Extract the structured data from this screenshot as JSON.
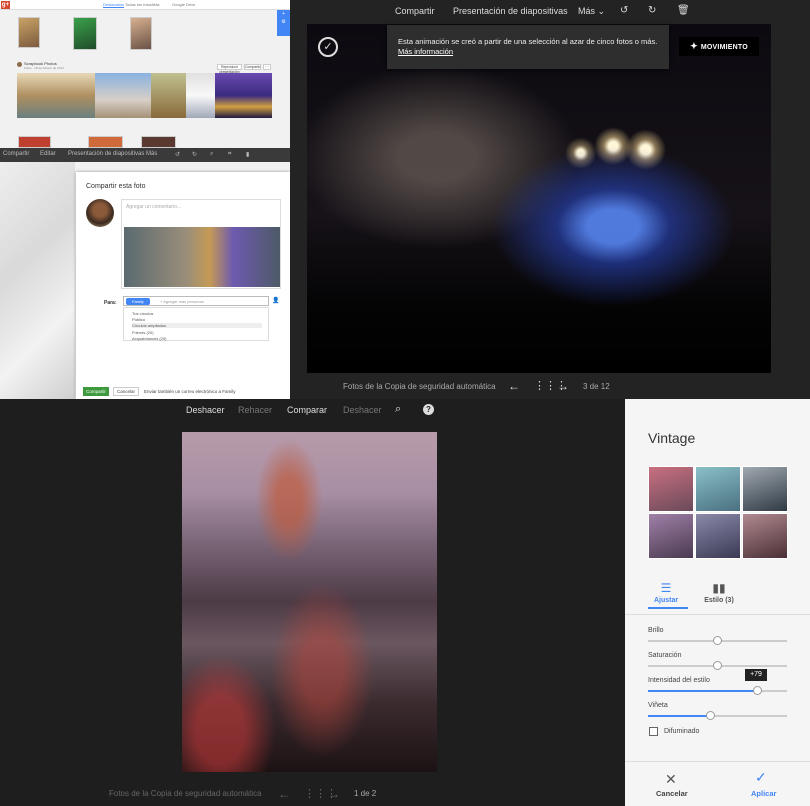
{
  "top_left": {
    "nav": {
      "item1": "Destacados",
      "item2": "Todas tus fotos",
      "item3": "Más",
      "item4": "Google Drive"
    },
    "side_icons": [
      "+",
      "⚙"
    ],
    "album": {
      "name": "Scrapbook Photos",
      "meta": "Fotos · 18 de febrero de 2014",
      "btn1": "Reproducir presentación",
      "btn2": "Compartir",
      "btn3": "···"
    },
    "toolbar": {
      "share": "Compartir",
      "edit": "Editar",
      "slideshow": "Presentación de diapositivas",
      "more": "Más"
    },
    "share_dialog": {
      "title": "Compartir esta foto",
      "comment_placeholder": "Agregar un comentario...",
      "to_label": "Para:",
      "chip": "Family",
      "add_people": "+ Agregar más personas",
      "options": [
        "Tus círculos",
        "Público",
        "Círculos ampliados",
        "Friends (20)",
        "Acquaintances (29)"
      ],
      "share_button": "Compartir",
      "cancel_button": "Cancelar",
      "email_text": "Enviar también un correo electrónico a Family"
    }
  },
  "top_right": {
    "toolbar": {
      "share": "Compartir",
      "slideshow": "Presentación de diapositivas",
      "more": "Más"
    },
    "tooltip": {
      "text": "Esta animación se creó a partir de una selección al azar de cinco fotos o más.",
      "link": "Más información"
    },
    "movimiento_button": "MOVIMIENTO",
    "footer": {
      "source": "Fotos de la Copia de seguridad automática",
      "counter": "3 de 12"
    }
  },
  "bottom_left": {
    "toolbar": {
      "undo": "Deshacer",
      "redo": "Rehacer",
      "compare": "Comparar",
      "undo2": "Deshacer"
    },
    "footer": {
      "source": "Fotos de la Copia de seguridad automática",
      "counter": "1 de 2"
    }
  },
  "bottom_right": {
    "title": "Vintage",
    "tabs": {
      "adjust": "Ajustar",
      "style": "Estilo (3)"
    },
    "sliders": [
      {
        "label": "Brillo",
        "value": 0.5
      },
      {
        "label": "Saturación",
        "value": 0.5
      },
      {
        "label": "Intensidad del estilo",
        "value": 0.79,
        "tooltip": "+79"
      },
      {
        "label": "Viñeta",
        "value": 0.45
      }
    ],
    "checkbox_label": "Difuminado",
    "cancel": "Cancelar",
    "apply": "Aplicar"
  },
  "colors": {
    "accent": "#4285f4",
    "share_green": "#3d9a3d",
    "gplus_red": "#d6492f"
  }
}
